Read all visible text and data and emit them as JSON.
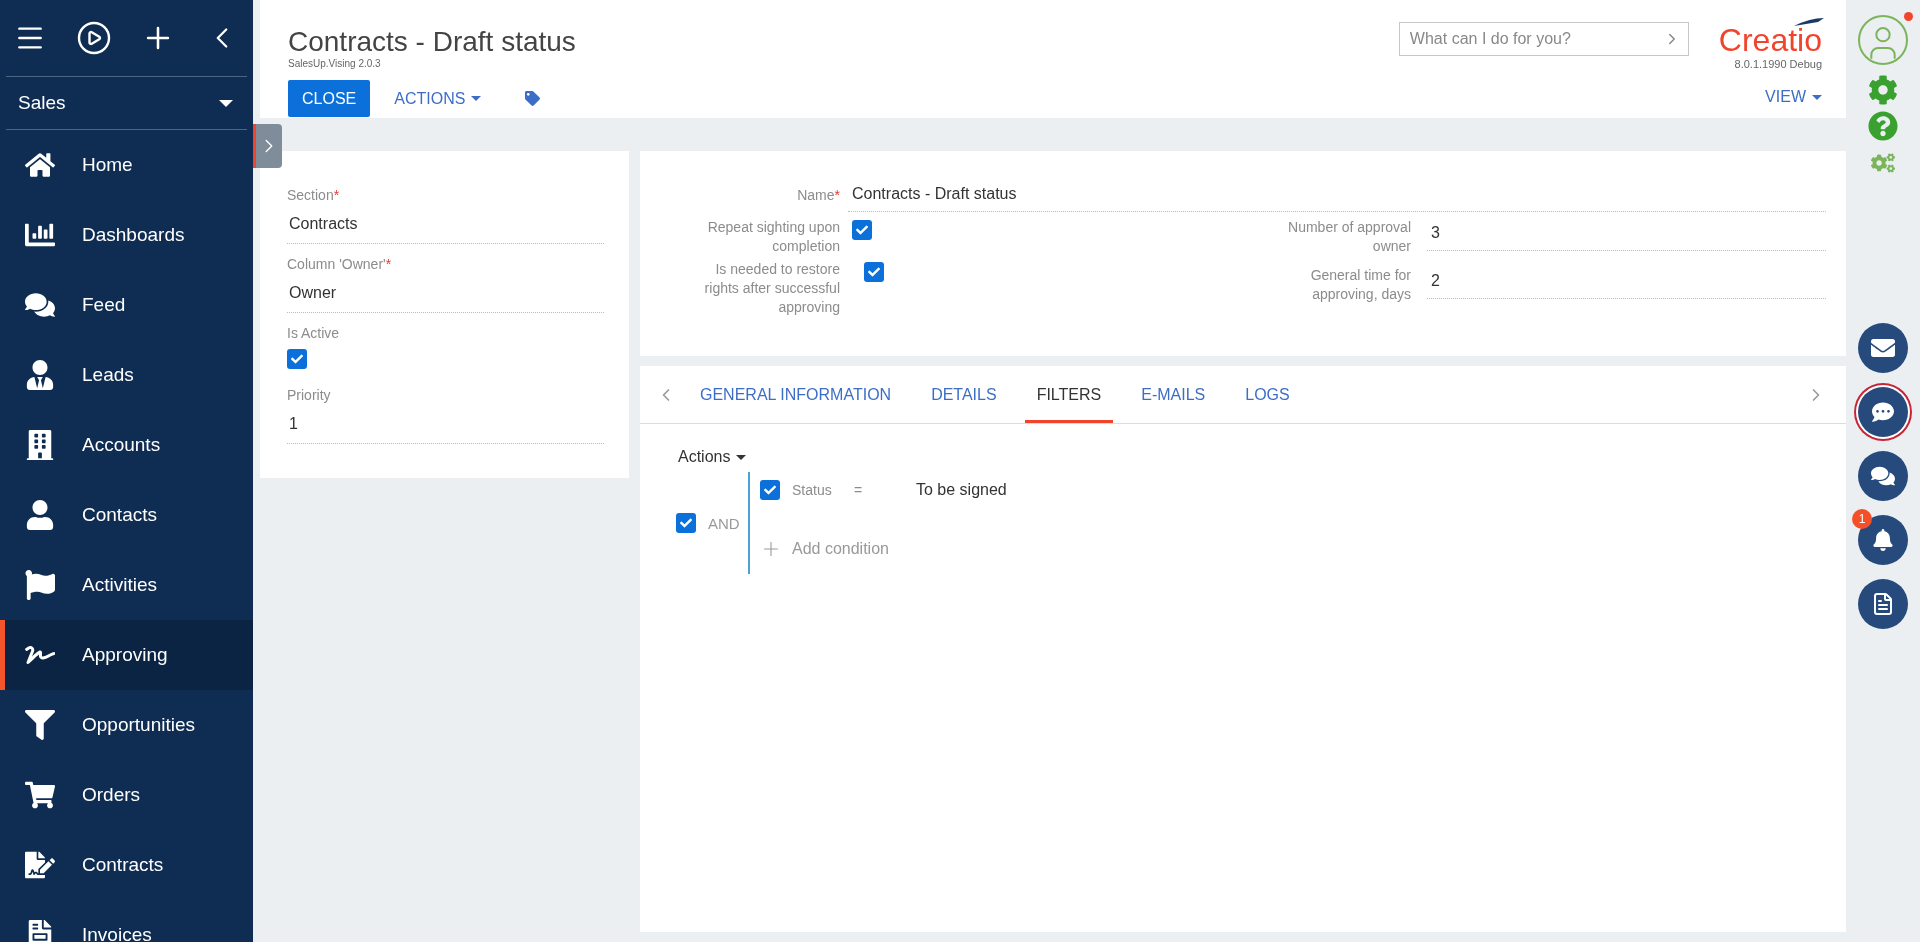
{
  "sidebar": {
    "workplace": "Sales",
    "items": [
      {
        "label": "Home",
        "selected": false
      },
      {
        "label": "Dashboards",
        "selected": false
      },
      {
        "label": "Feed",
        "selected": false
      },
      {
        "label": "Leads",
        "selected": false
      },
      {
        "label": "Accounts",
        "selected": false
      },
      {
        "label": "Contacts",
        "selected": false
      },
      {
        "label": "Activities",
        "selected": false
      },
      {
        "label": "Approving",
        "selected": true
      },
      {
        "label": "Opportunities",
        "selected": false
      },
      {
        "label": "Orders",
        "selected": false
      },
      {
        "label": "Contracts",
        "selected": false
      },
      {
        "label": "Invoices",
        "selected": false
      }
    ]
  },
  "header": {
    "title": "Contracts - Draft status",
    "subtitle": "SalesUp.Vising 2.0.3",
    "close": "CLOSE",
    "actions": "ACTIONS",
    "view": "VIEW",
    "search": {
      "placeholder": "What can I do for you?"
    },
    "logo": "Creatio",
    "version": "8.0.1.1990 Debug"
  },
  "left_form": {
    "fields": [
      {
        "kind": "text",
        "label": "Section",
        "required_mark": "*",
        "value": "Contracts"
      },
      {
        "kind": "text",
        "label": "Column 'Owner'",
        "required_mark": "*",
        "value": "Owner"
      },
      {
        "kind": "checkbox",
        "label": "Is Active",
        "checked": true
      },
      {
        "kind": "text",
        "label": "Priority",
        "value": "1"
      }
    ]
  },
  "main_form": {
    "name": {
      "label": "Name",
      "required_mark": "*",
      "value": "Contracts - Draft status"
    },
    "left_column": [
      {
        "label": "Repeat sighting upon completion",
        "checked": true
      },
      {
        "label": "Is needed to restore rights after successful approving",
        "checked": true
      }
    ],
    "right_column": [
      {
        "label": "Number of approval owner",
        "value": "3"
      },
      {
        "label": "General time for approving, days",
        "value": "2"
      }
    ]
  },
  "tabs": [
    {
      "label": "GENERAL INFORMATION",
      "selected": false
    },
    {
      "label": "DETAILS",
      "selected": false
    },
    {
      "label": "FILTERS",
      "selected": true
    },
    {
      "label": "E-MAILS",
      "selected": false
    },
    {
      "label": "LOGS",
      "selected": false
    }
  ],
  "filters": {
    "actions": "Actions",
    "group": {
      "operator": "AND",
      "checked": true,
      "conditions": [
        {
          "checked": true,
          "column": "Status",
          "operator": "=",
          "value": "To be signed"
        }
      ],
      "add": "Add condition"
    }
  },
  "rail": {
    "notifications_badge": "1",
    "chat_selected": true
  }
}
